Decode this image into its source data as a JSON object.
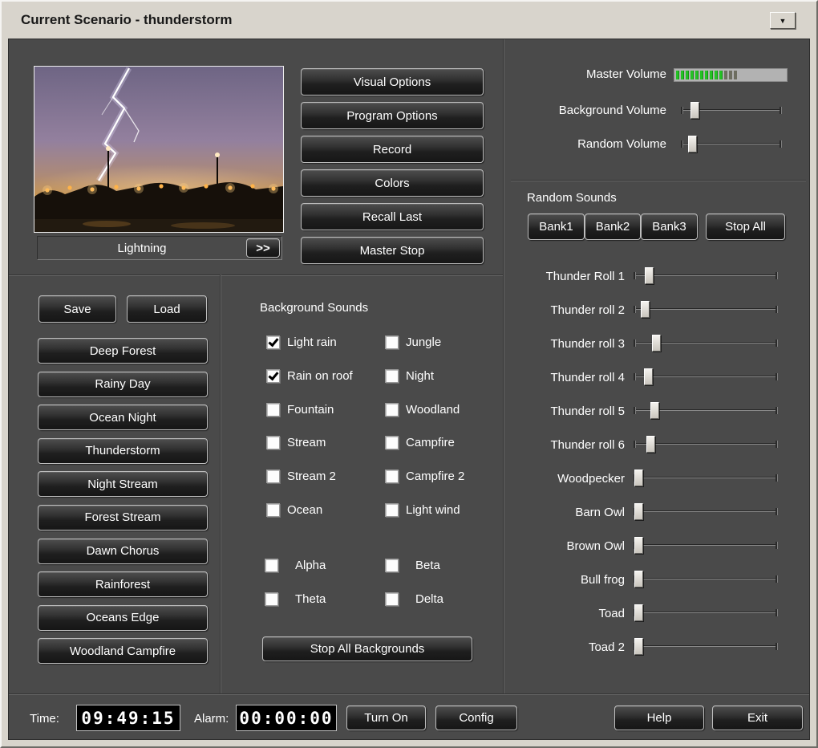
{
  "window": {
    "title": "Current Scenario - thunderstorm",
    "menu_glyph": "▼"
  },
  "preview": {
    "label": "Lightning",
    "next_label": ">>"
  },
  "top_buttons": [
    "Visual Options",
    "Program Options",
    "Record",
    "Colors",
    "Recall Last",
    "Master Stop"
  ],
  "volumes": {
    "master_label": "Master Volume",
    "background_label": "Background Volume",
    "random_label": "Random Volume",
    "background_value": 10,
    "random_value": 7,
    "meter": {
      "green_segments": 10,
      "dim_segments": 3
    }
  },
  "random_sounds": {
    "title": "Random Sounds",
    "bank_buttons": [
      "Bank1",
      "Bank2",
      "Bank3"
    ],
    "stop_all_label": "Stop All",
    "sliders": [
      {
        "label": "Thunder Roll 1",
        "value": 8
      },
      {
        "label": "Thunder roll 2",
        "value": 5
      },
      {
        "label": "Thunder roll 3",
        "value": 13
      },
      {
        "label": "Thunder roll 4",
        "value": 7
      },
      {
        "label": "Thunder roll 5",
        "value": 12
      },
      {
        "label": "Thunder roll 6",
        "value": 9
      },
      {
        "label": "Woodpecker",
        "value": 0
      },
      {
        "label": "Barn Owl",
        "value": 0
      },
      {
        "label": "Brown Owl",
        "value": 0
      },
      {
        "label": "Bull frog",
        "value": 0
      },
      {
        "label": "Toad",
        "value": 0
      },
      {
        "label": "Toad 2",
        "value": 0
      }
    ]
  },
  "scenarios": {
    "save_label": "Save",
    "load_label": "Load",
    "presets": [
      "Deep Forest",
      "Rainy Day",
      "Ocean Night",
      "Thunderstorm",
      "Night Stream",
      "Forest Stream",
      "Dawn Chorus",
      "Rainforest",
      "Oceans Edge",
      "Woodland Campfire"
    ]
  },
  "background_sounds": {
    "title": "Background Sounds",
    "col1": [
      {
        "label": "Light rain",
        "checked": true
      },
      {
        "label": "Rain on roof",
        "checked": true
      },
      {
        "label": "Fountain",
        "checked": false
      },
      {
        "label": "Stream",
        "checked": false
      },
      {
        "label": "Stream 2",
        "checked": false
      },
      {
        "label": "Ocean",
        "checked": false
      }
    ],
    "col2": [
      {
        "label": "Jungle",
        "checked": false
      },
      {
        "label": "Night",
        "checked": false
      },
      {
        "label": "Woodland",
        "checked": false
      },
      {
        "label": "Campfire",
        "checked": false
      },
      {
        "label": "Campfire 2",
        "checked": false
      },
      {
        "label": "Light wind",
        "checked": false
      }
    ],
    "waves1": [
      {
        "label": "Alpha",
        "checked": false
      },
      {
        "label": "Theta",
        "checked": false
      }
    ],
    "waves2": [
      {
        "label": "Beta",
        "checked": false
      },
      {
        "label": "Delta",
        "checked": false
      }
    ],
    "stop_all_label": "Stop All Backgrounds"
  },
  "bottom_bar": {
    "time_label": "Time:",
    "time_value": "09:49:15",
    "alarm_label": "Alarm:",
    "alarm_value": "00:00:00",
    "turn_on_label": "Turn On",
    "config_label": "Config",
    "help_label": "Help",
    "exit_label": "Exit"
  },
  "colors": {
    "panel": "#4a4a4a",
    "chrome": "#d8d4cc",
    "meter_green": "#25c125"
  }
}
